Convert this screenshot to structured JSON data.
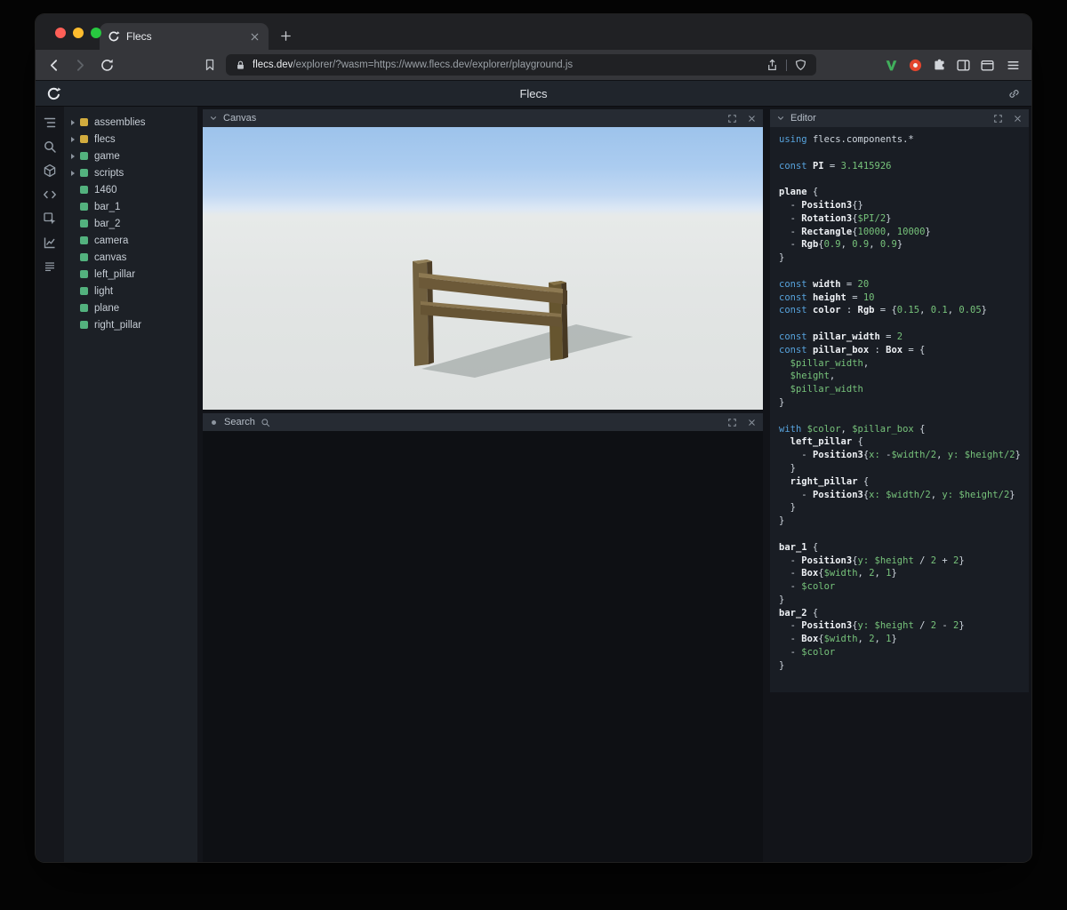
{
  "browser": {
    "tab_title": "Flecs",
    "url_domain": "flecs.dev",
    "url_path": "/explorer/?wasm=https://www.flecs.dev/explorer/playground.js",
    "toolbar_icons": [
      "back",
      "forward",
      "reload",
      "bookmark",
      "lock",
      "share",
      "shield",
      "v-extension",
      "red-extension",
      "extensions-puzzle",
      "sidebar",
      "wallet",
      "menu"
    ]
  },
  "app": {
    "title": "Flecs",
    "logo_icon": "flecs-spiral",
    "header_right_icon": "link"
  },
  "rail": {
    "icons": [
      "hierarchy",
      "search",
      "entities",
      "code",
      "inspect",
      "stats",
      "queries"
    ]
  },
  "tree": {
    "items": [
      {
        "label": "assemblies",
        "color": "#d2ac3e",
        "expandable": true
      },
      {
        "label": "flecs",
        "color": "#d2ac3e",
        "expandable": true
      },
      {
        "label": "game",
        "color": "#53b27e",
        "expandable": true
      },
      {
        "label": "scripts",
        "color": "#53b27e",
        "expandable": true
      },
      {
        "label": "1460",
        "color": "#53b27e",
        "expandable": false
      },
      {
        "label": "bar_1",
        "color": "#53b27e",
        "expandable": false
      },
      {
        "label": "bar_2",
        "color": "#53b27e",
        "expandable": false
      },
      {
        "label": "camera",
        "color": "#53b27e",
        "expandable": false
      },
      {
        "label": "canvas",
        "color": "#53b27e",
        "expandable": false
      },
      {
        "label": "left_pillar",
        "color": "#53b27e",
        "expandable": false
      },
      {
        "label": "light",
        "color": "#53b27e",
        "expandable": false
      },
      {
        "label": "plane",
        "color": "#53b27e",
        "expandable": false
      },
      {
        "label": "right_pillar",
        "color": "#53b27e",
        "expandable": false
      }
    ]
  },
  "panels": {
    "canvas": {
      "title": "Canvas"
    },
    "search": {
      "title": "Search"
    },
    "editor": {
      "title": "Editor"
    }
  },
  "colors": {
    "module_square": "#d2ac3e",
    "entity_square": "#53b27e",
    "code_keyword": "#57a3dd",
    "code_value": "#77c37b",
    "traffic_red": "#ff5f57",
    "traffic_yellow": "#febc2e",
    "traffic_green": "#28c840"
  },
  "code": {
    "lines": [
      [
        [
          "k",
          "using "
        ],
        [
          "t",
          "flecs.components.*"
        ]
      ],
      [],
      [
        [
          "k",
          "const "
        ],
        [
          "b",
          "PI"
        ],
        [
          "t",
          " = "
        ],
        [
          "v",
          "3.1415926"
        ]
      ],
      [],
      [
        [
          "b",
          "plane"
        ],
        [
          "t",
          " {"
        ]
      ],
      [
        [
          "t",
          "  - "
        ],
        [
          "b",
          "Position3"
        ],
        [
          "t",
          "{}"
        ]
      ],
      [
        [
          "t",
          "  - "
        ],
        [
          "b",
          "Rotation3"
        ],
        [
          "t",
          "{"
        ],
        [
          "v",
          "$PI/2"
        ],
        [
          "t",
          "}"
        ]
      ],
      [
        [
          "t",
          "  - "
        ],
        [
          "b",
          "Rectangle"
        ],
        [
          "t",
          "{"
        ],
        [
          "v",
          "10000"
        ],
        [
          "t",
          ", "
        ],
        [
          "v",
          "10000"
        ],
        [
          "t",
          "}"
        ]
      ],
      [
        [
          "t",
          "  - "
        ],
        [
          "b",
          "Rgb"
        ],
        [
          "t",
          "{"
        ],
        [
          "v",
          "0.9"
        ],
        [
          "t",
          ", "
        ],
        [
          "v",
          "0.9"
        ],
        [
          "t",
          ", "
        ],
        [
          "v",
          "0.9"
        ],
        [
          "t",
          "}"
        ]
      ],
      [
        [
          "t",
          "}"
        ]
      ],
      [],
      [
        [
          "k",
          "const "
        ],
        [
          "b",
          "width"
        ],
        [
          "t",
          " = "
        ],
        [
          "v",
          "20"
        ]
      ],
      [
        [
          "k",
          "const "
        ],
        [
          "b",
          "height"
        ],
        [
          "t",
          " = "
        ],
        [
          "v",
          "10"
        ]
      ],
      [
        [
          "k",
          "const "
        ],
        [
          "b",
          "color"
        ],
        [
          "t",
          " : "
        ],
        [
          "b",
          "Rgb"
        ],
        [
          "t",
          " = {"
        ],
        [
          "v",
          "0.15"
        ],
        [
          "t",
          ", "
        ],
        [
          "v",
          "0.1"
        ],
        [
          "t",
          ", "
        ],
        [
          "v",
          "0.05"
        ],
        [
          "t",
          "}"
        ]
      ],
      [],
      [
        [
          "k",
          "const "
        ],
        [
          "b",
          "pillar_width"
        ],
        [
          "t",
          " = "
        ],
        [
          "v",
          "2"
        ]
      ],
      [
        [
          "k",
          "const "
        ],
        [
          "b",
          "pillar_box"
        ],
        [
          "t",
          " : "
        ],
        [
          "b",
          "Box"
        ],
        [
          "t",
          " = {"
        ]
      ],
      [
        [
          "t",
          "  "
        ],
        [
          "v",
          "$pillar_width"
        ],
        [
          "t",
          ","
        ]
      ],
      [
        [
          "t",
          "  "
        ],
        [
          "v",
          "$height"
        ],
        [
          "t",
          ","
        ]
      ],
      [
        [
          "t",
          "  "
        ],
        [
          "v",
          "$pillar_width"
        ]
      ],
      [
        [
          "t",
          "}"
        ]
      ],
      [],
      [
        [
          "k",
          "with "
        ],
        [
          "v",
          "$color"
        ],
        [
          "t",
          ", "
        ],
        [
          "v",
          "$pillar_box"
        ],
        [
          "t",
          " {"
        ]
      ],
      [
        [
          "t",
          "  "
        ],
        [
          "b",
          "left_pillar"
        ],
        [
          "t",
          " {"
        ]
      ],
      [
        [
          "t",
          "    - "
        ],
        [
          "b",
          "Position3"
        ],
        [
          "t",
          "{"
        ],
        [
          "v",
          "x:"
        ],
        [
          "t",
          " -"
        ],
        [
          "v",
          "$width/2"
        ],
        [
          "t",
          ", "
        ],
        [
          "v",
          "y:"
        ],
        [
          "t",
          " "
        ],
        [
          "v",
          "$height/2"
        ],
        [
          "t",
          "}"
        ]
      ],
      [
        [
          "t",
          "  }"
        ]
      ],
      [
        [
          "t",
          "  "
        ],
        [
          "b",
          "right_pillar"
        ],
        [
          "t",
          " {"
        ]
      ],
      [
        [
          "t",
          "    - "
        ],
        [
          "b",
          "Position3"
        ],
        [
          "t",
          "{"
        ],
        [
          "v",
          "x:"
        ],
        [
          "t",
          " "
        ],
        [
          "v",
          "$width/2"
        ],
        [
          "t",
          ", "
        ],
        [
          "v",
          "y:"
        ],
        [
          "t",
          " "
        ],
        [
          "v",
          "$height/2"
        ],
        [
          "t",
          "}"
        ]
      ],
      [
        [
          "t",
          "  }"
        ]
      ],
      [
        [
          "t",
          "}"
        ]
      ],
      [],
      [
        [
          "b",
          "bar_1"
        ],
        [
          "t",
          " {"
        ]
      ],
      [
        [
          "t",
          "  - "
        ],
        [
          "b",
          "Position3"
        ],
        [
          "t",
          "{"
        ],
        [
          "v",
          "y:"
        ],
        [
          "t",
          " "
        ],
        [
          "v",
          "$height"
        ],
        [
          "t",
          " / "
        ],
        [
          "v",
          "2"
        ],
        [
          "t",
          " + "
        ],
        [
          "v",
          "2"
        ],
        [
          "t",
          "}"
        ]
      ],
      [
        [
          "t",
          "  - "
        ],
        [
          "b",
          "Box"
        ],
        [
          "t",
          "{"
        ],
        [
          "v",
          "$width"
        ],
        [
          "t",
          ", "
        ],
        [
          "v",
          "2"
        ],
        [
          "t",
          ", "
        ],
        [
          "v",
          "1"
        ],
        [
          "t",
          "}"
        ]
      ],
      [
        [
          "t",
          "  - "
        ],
        [
          "v",
          "$color"
        ]
      ],
      [
        [
          "t",
          "}"
        ]
      ],
      [
        [
          "b",
          "bar_2"
        ],
        [
          "t",
          " {"
        ]
      ],
      [
        [
          "t",
          "  - "
        ],
        [
          "b",
          "Position3"
        ],
        [
          "t",
          "{"
        ],
        [
          "v",
          "y:"
        ],
        [
          "t",
          " "
        ],
        [
          "v",
          "$height"
        ],
        [
          "t",
          " / "
        ],
        [
          "v",
          "2"
        ],
        [
          "t",
          " - "
        ],
        [
          "v",
          "2"
        ],
        [
          "t",
          "}"
        ]
      ],
      [
        [
          "t",
          "  - "
        ],
        [
          "b",
          "Box"
        ],
        [
          "t",
          "{"
        ],
        [
          "v",
          "$width"
        ],
        [
          "t",
          ", "
        ],
        [
          "v",
          "2"
        ],
        [
          "t",
          ", "
        ],
        [
          "v",
          "1"
        ],
        [
          "t",
          "}"
        ]
      ],
      [
        [
          "t",
          "  - "
        ],
        [
          "v",
          "$color"
        ]
      ],
      [
        [
          "t",
          "}"
        ]
      ]
    ]
  }
}
